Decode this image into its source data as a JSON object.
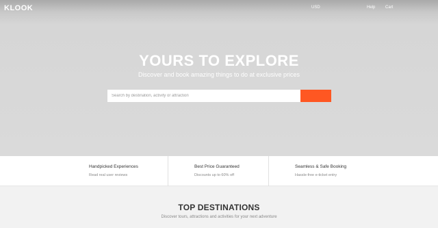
{
  "header": {
    "logo": "KLOOK",
    "currency": "USD",
    "help": "Help",
    "cart": "Cart"
  },
  "hero": {
    "title": "YOURS TO EXPLORE",
    "subtitle": "Discover and book amazing things to do at exclusive prices",
    "search_placeholder": "Search by destination, activity or attraction"
  },
  "features": [
    {
      "title": "Handpicked Experiences",
      "desc": "Read real user reviews"
    },
    {
      "title": "Best Price Guaranteed",
      "desc": "Discounts up to 60% off"
    },
    {
      "title": "Seamless & Safe Booking",
      "desc": "Hassle-free e-ticket entry"
    }
  ],
  "destinations": {
    "title": "TOP DESTINATIONS",
    "subtitle": "Discover tours, attractions and activities for your next adventure"
  },
  "colors": {
    "accent": "#ff5722"
  }
}
